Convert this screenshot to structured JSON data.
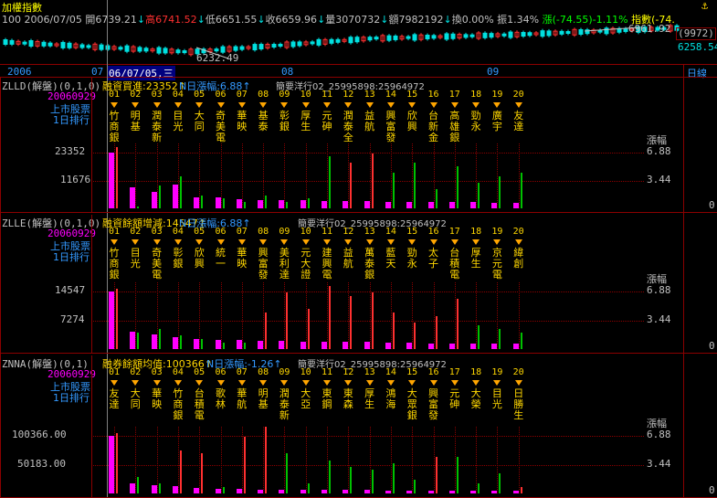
{
  "header": {
    "title": "加權指數",
    "quote": {
      "code": "100",
      "date": "2006/07/05",
      "open": "開6739.21",
      "high": "高6741.52",
      "low": "低6651.55",
      "close": "收6659.96",
      "volume": "量3070732",
      "amount": "額7982192",
      "turnover": "換0.00%",
      "amplitude": "振1.34%",
      "change": "漲(-74.55)-1.11%",
      "index": "指數(-74."
    },
    "right_value_1": "(9972)",
    "right_value_2": "6258.54",
    "price_high_label": "6961.92",
    "price_low_label": "6232.49",
    "year_label": "2006",
    "month_labels": [
      "07",
      "08",
      "09"
    ],
    "cursor_date": "06/07/05,三",
    "period_button": "日線"
  },
  "panels": [
    {
      "id": "ZLLD",
      "indicator": "ZLLD(解盤)(0,1,0)",
      "title_main": "融資買進:23352",
      "title_ndays": "N日漲幅:6.88",
      "title_extra": "簡要洋行02_25995898:25964972",
      "date": "20060929",
      "subtitle1": "上市股票",
      "subtitle2": "1日排行",
      "y_top": "23352",
      "y_mid": "11676",
      "right_top": "6.88",
      "right_mid": "3.44",
      "right_zero": "0",
      "right_label": "漲幅",
      "columns": [
        {
          "no": "01",
          "name": "竹商銀"
        },
        {
          "no": "02",
          "name": "明基"
        },
        {
          "no": "03",
          "name": "潤泰新"
        },
        {
          "no": "04",
          "name": "目光"
        },
        {
          "no": "05",
          "name": "大同"
        },
        {
          "no": "06",
          "name": "奇美電"
        },
        {
          "no": "07",
          "name": "華映"
        },
        {
          "no": "08",
          "name": "基泰"
        },
        {
          "no": "09",
          "name": "彰銀"
        },
        {
          "no": "10",
          "name": "厚生"
        },
        {
          "no": "11",
          "name": "元砷"
        },
        {
          "no": "12",
          "name": "潤泰全"
        },
        {
          "no": "13",
          "name": "益航"
        },
        {
          "no": "14",
          "name": "興富發"
        },
        {
          "no": "15",
          "name": "欣興"
        },
        {
          "no": "16",
          "name": "台新金"
        },
        {
          "no": "17",
          "name": "高雄銀"
        },
        {
          "no": "18",
          "name": "勁永"
        },
        {
          "no": "19",
          "name": "廣宇"
        },
        {
          "no": "20",
          "name": "友達"
        }
      ]
    },
    {
      "id": "ZLLE",
      "indicator": "ZLLE(解盤)(0,1,0)",
      "title_main": "融資餘額增減:14547",
      "title_ndays": "N日漲幅:6.88",
      "title_extra": "簡要洋行02_25995898:25964972",
      "date": "20060929",
      "subtitle1": "上市股票",
      "subtitle2": "1日排行",
      "y_top": "14547",
      "y_mid": "7274",
      "right_top": "6.88",
      "right_mid": "3.44",
      "right_zero": "0",
      "right_label": "漲幅",
      "columns": [
        {
          "no": "01",
          "name": "竹商銀"
        },
        {
          "no": "02",
          "name": "目光"
        },
        {
          "no": "03",
          "name": "奇美電"
        },
        {
          "no": "04",
          "name": "彰銀"
        },
        {
          "no": "05",
          "name": "欣興"
        },
        {
          "no": "06",
          "name": "統一"
        },
        {
          "no": "07",
          "name": "華映"
        },
        {
          "no": "08",
          "name": "興富發"
        },
        {
          "no": "09",
          "name": "美利達"
        },
        {
          "no": "10",
          "name": "元大證"
        },
        {
          "no": "11",
          "name": "建興電"
        },
        {
          "no": "12",
          "name": "益航"
        },
        {
          "no": "13",
          "name": "萬泰銀"
        },
        {
          "no": "14",
          "name": "藍天"
        },
        {
          "no": "15",
          "name": "勁永"
        },
        {
          "no": "16",
          "name": "太子"
        },
        {
          "no": "17",
          "name": "台積電"
        },
        {
          "no": "18",
          "name": "厚生"
        },
        {
          "no": "19",
          "name": "京元電"
        },
        {
          "no": "20",
          "name": "緯創"
        }
      ]
    },
    {
      "id": "ZNNA",
      "indicator": "ZNNA(解盤)(0,1)",
      "title_main": "融券餘額均值:100366",
      "title_ndays": "N日漲幅:-1.26",
      "title_extra": "簡要洋行02_25995898:25964972",
      "date": "20060929",
      "subtitle1": "上市股票",
      "subtitle2": "1日排行",
      "y_top": "100366.00",
      "y_mid": "50183.00",
      "right_top": "6.88",
      "right_mid": "3.44",
      "right_zero": "0",
      "right_label": "漲幅",
      "columns": [
        {
          "no": "01",
          "name": "友達"
        },
        {
          "no": "02",
          "name": "大同"
        },
        {
          "no": "03",
          "name": "華映"
        },
        {
          "no": "04",
          "name": "竹商銀"
        },
        {
          "no": "05",
          "name": "台積電"
        },
        {
          "no": "06",
          "name": "歌林"
        },
        {
          "no": "07",
          "name": "華航"
        },
        {
          "no": "08",
          "name": "明基"
        },
        {
          "no": "09",
          "name": "潤泰新"
        },
        {
          "no": "10",
          "name": "大亞"
        },
        {
          "no": "11",
          "name": "東鋼"
        },
        {
          "no": "12",
          "name": "東森"
        },
        {
          "no": "13",
          "name": "厚生"
        },
        {
          "no": "14",
          "name": "鴻海"
        },
        {
          "no": "15",
          "name": "大眾銀"
        },
        {
          "no": "16",
          "name": "興富發"
        },
        {
          "no": "17",
          "name": "元砷"
        },
        {
          "no": "18",
          "name": "大榮"
        },
        {
          "no": "19",
          "name": "目光"
        },
        {
          "no": "20",
          "name": "日勝生"
        }
      ]
    }
  ],
  "colors": {
    "up": "#ff3030",
    "down": "#00e0e0",
    "magenta": "#ff00ff",
    "green": "#00c000",
    "grid": "#8b0000",
    "label": "#ffd700",
    "blue": "#3399ff"
  }
}
